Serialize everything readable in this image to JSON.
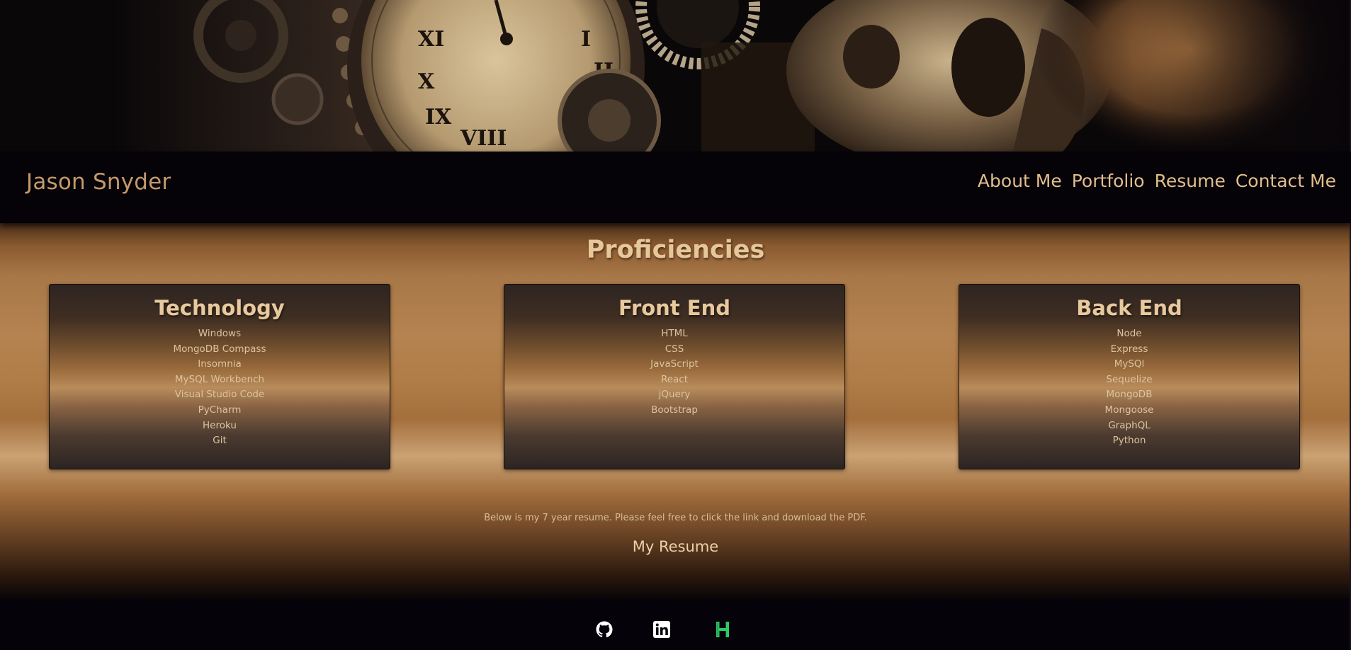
{
  "header": {
    "brand": "Jason Snyder",
    "nav": [
      "About Me",
      "Portfolio",
      "Resume",
      "Contact Me"
    ]
  },
  "banner": {
    "description_icon": "steampunk-clock-skull-banner"
  },
  "proficiencies": {
    "title": "Proficiencies",
    "cards": [
      {
        "title": "Technology",
        "items": [
          "Windows",
          "MongoDB Compass",
          "Insomnia",
          "MySQL Workbench",
          "Visual Studio Code",
          "PyCharm",
          "Heroku",
          "Git"
        ]
      },
      {
        "title": "Front End",
        "items": [
          "HTML",
          "CSS",
          "JavaScript",
          "React",
          "jQuery",
          "Bootstrap"
        ]
      },
      {
        "title": "Back End",
        "items": [
          "Node",
          "Express",
          "MySQl",
          "Sequelize",
          "MongoDB",
          "Mongoose",
          "GraphQL",
          "Python"
        ]
      }
    ]
  },
  "resume": {
    "text": "Below is my 7 year resume. Please feel free to click the link and download the PDF.",
    "link_label": "My Resume"
  },
  "footer": {
    "icons": [
      "github-icon",
      "linkedin-icon",
      "hackerrank-icon"
    ],
    "colors": {
      "github": "#ffffff",
      "linkedin": "#ffffff",
      "hackerrank": "#2ec866"
    }
  },
  "colors": {
    "brand": "#c49a69",
    "nav": "#e2be8c",
    "accent": "#b07c47",
    "background": "#06030a"
  }
}
